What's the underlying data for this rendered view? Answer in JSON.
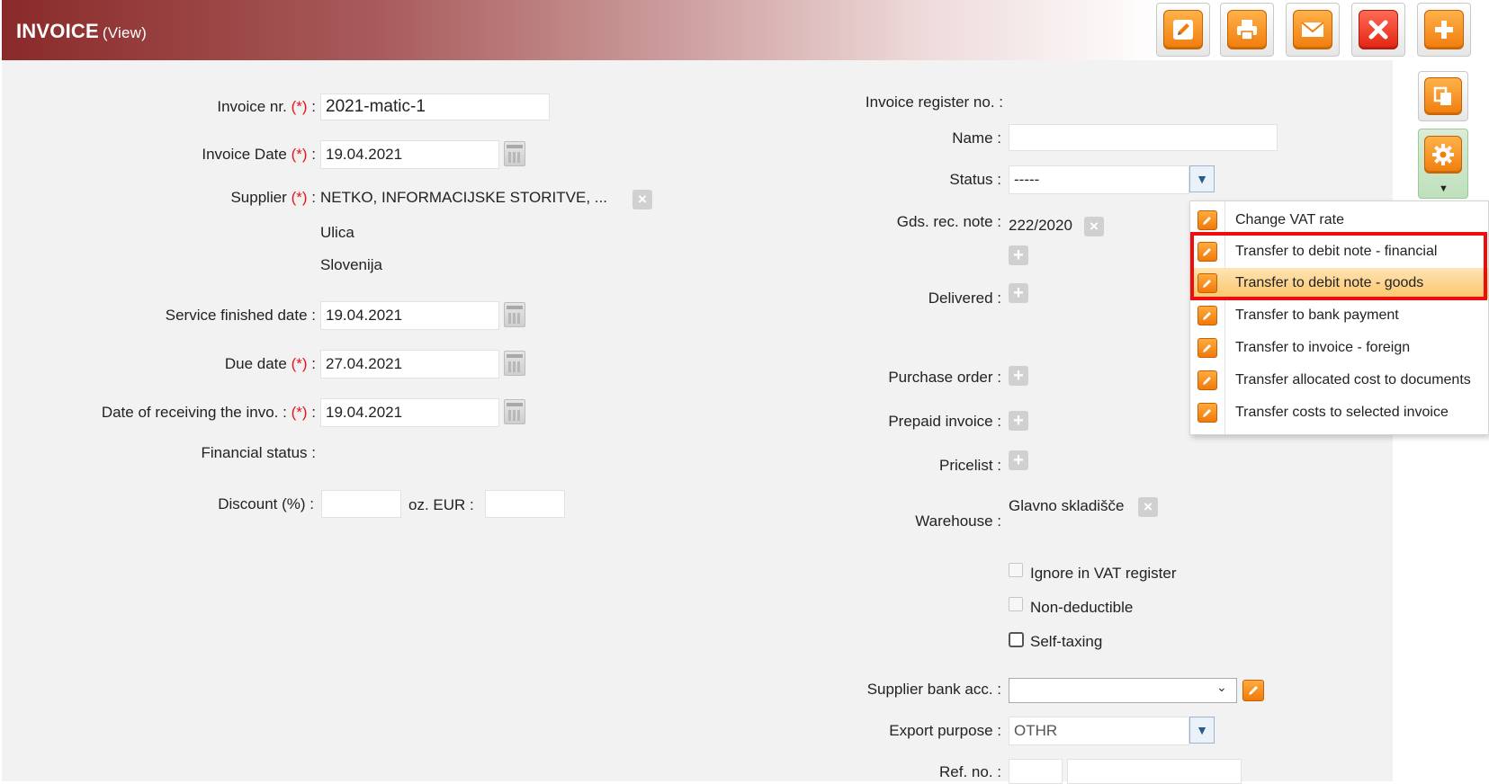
{
  "header": {
    "title": "INVOICE",
    "subtitle": "(View)"
  },
  "toolbar": [
    {
      "name": "edit-button",
      "icon": "pencil-icon"
    },
    {
      "name": "print-button",
      "icon": "printer-icon"
    },
    {
      "name": "email-button",
      "icon": "envelope-icon"
    },
    {
      "name": "close-button",
      "icon": "close-icon"
    },
    {
      "name": "add-button",
      "icon": "plus-icon"
    }
  ],
  "left": {
    "invoice_nr_label": "Invoice nr.",
    "invoice_nr": "2021-matic-1",
    "invoice_date_label": "Invoice Date",
    "invoice_date": "19.04.2021",
    "supplier_label": "Supplier",
    "supplier_name": "NETKO, INFORMACIJSKE STORITVE, ...",
    "supplier_street": "Ulica",
    "supplier_country": "Slovenija",
    "service_finished_label": "Service finished date :",
    "service_finished": "19.04.2021",
    "due_date_label": "Due date",
    "due_date": "27.04.2021",
    "date_receiving_label": "Date of receiving the invo. :",
    "date_receiving": "19.04.2021",
    "financial_status_label": "Financial status :",
    "discount_label": "Discount (%) :",
    "discount_value": "",
    "oz_eur_label": "oz. EUR :",
    "oz_eur_value": "",
    "required_marker": "(*)",
    "colon": ":"
  },
  "right": {
    "register_no_label": "Invoice register no. :",
    "name_label": "Name :",
    "name_value": "",
    "status_label": "Status :",
    "status_value": "-----",
    "gds_rec_label": "Gds. rec. note :",
    "gds_rec_value": "222/2020",
    "delivered_label": "Delivered :",
    "purchase_order_label": "Purchase order :",
    "prepaid_invoice_label": "Prepaid invoice :",
    "pricelist_label": "Pricelist :",
    "warehouse_label": "Warehouse :",
    "warehouse_value": "Glavno skladišče",
    "ignore_vat_label": "Ignore in VAT register",
    "non_deductible_label": "Non-deductible",
    "self_taxing_label": "Self-taxing",
    "supplier_bank_label": "Supplier bank acc. :",
    "supplier_bank_value": "",
    "export_purpose_label": "Export purpose :",
    "export_purpose_value": "OTHR",
    "ref_no_label": "Ref. no. :"
  },
  "menu": {
    "items": [
      {
        "label": "Change VAT rate",
        "highlighted": false
      },
      {
        "label": "Transfer to debit note - financial",
        "highlighted": false
      },
      {
        "label": "Transfer to debit note - goods",
        "highlighted": true
      },
      {
        "label": "Transfer to bank payment",
        "highlighted": false
      },
      {
        "label": "Transfer to invoice - foreign",
        "highlighted": false
      },
      {
        "label": "Transfer allocated cost to documents",
        "highlighted": false
      },
      {
        "label": "Transfer costs to selected invoice",
        "highlighted": false
      }
    ]
  },
  "colors": {
    "header_dark": "#8a2a2a",
    "accent_orange": "#f07d0c",
    "required": "#e8141c",
    "highlight_frame": "#ee0d0d"
  }
}
